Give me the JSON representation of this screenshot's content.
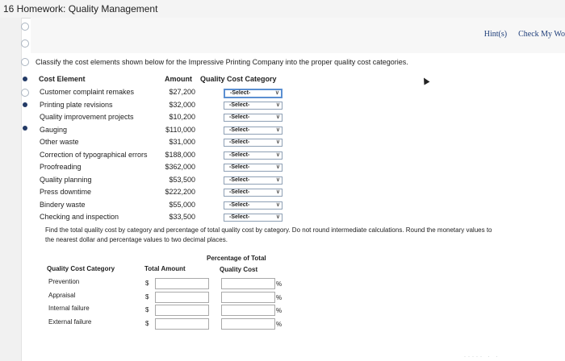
{
  "window_title": "16 Homework: Quality Management",
  "toolbar": {
    "hints_label": "Hint(s)",
    "check_label": "Check My Wo"
  },
  "instructions": "Classify the cost elements shown below for the Impressive Printing Company into the proper quality cost categories.",
  "classify_table": {
    "headers": {
      "element": "Cost Element",
      "amount": "Amount",
      "category": "Quality Cost Category"
    },
    "rows": [
      {
        "element": "Customer complaint remakes",
        "amount": "$27,200",
        "select": "-Select-"
      },
      {
        "element": "Printing plate revisions",
        "amount": "$32,000",
        "select": "-Select-"
      },
      {
        "element": "Quality improvement projects",
        "amount": "$10,200",
        "select": "-Select-"
      },
      {
        "element": "Gauging",
        "amount": "$110,000",
        "select": "-Select-"
      },
      {
        "element": "Other waste",
        "amount": "$31,000",
        "select": "-Select-"
      },
      {
        "element": "Correction of typographical errors",
        "amount": "$188,000",
        "select": "-Select-"
      },
      {
        "element": "Proofreading",
        "amount": "$362,000",
        "select": "-Select-"
      },
      {
        "element": "Quality planning",
        "amount": "$53,500",
        "select": "-Select-"
      },
      {
        "element": "Press downtime",
        "amount": "$222,200",
        "select": "-Select-"
      },
      {
        "element": "Bindery waste",
        "amount": "$55,000",
        "select": "-Select-"
      },
      {
        "element": "Checking and inspection",
        "amount": "$33,500",
        "select": "-Select-"
      }
    ]
  },
  "question2": {
    "line1": "Find the total quality cost by category and percentage of total quality cost by category. Do not round intermediate calculations. Round the monetary values to",
    "line2": "the nearest dollar and percentage values to two decimal places."
  },
  "summary_table": {
    "headers": {
      "category": "Quality Cost Category",
      "total": "Total Amount",
      "pct_line1": "Percentage of Total",
      "pct_line2": "Quality Cost"
    },
    "rows": [
      {
        "category": "Prevention",
        "currency": "$",
        "amount_value": "",
        "pct_value": "",
        "pct_sign": "%"
      },
      {
        "category": "Appraisal",
        "currency": "$",
        "amount_value": "",
        "pct_value": "",
        "pct_sign": "%"
      },
      {
        "category": "Internal failure",
        "currency": "$",
        "amount_value": "",
        "pct_value": "",
        "pct_sign": "%"
      },
      {
        "category": "External failure",
        "currency": "$",
        "amount_value": "",
        "pct_value": "",
        "pct_sign": "%"
      }
    ]
  },
  "icons": {
    "dropdown": "chevron-down-icon",
    "nav_radio": "radio-icon",
    "nav_current": "filled-dot-icon"
  },
  "colors": {
    "link": "#1f3e7a",
    "nav_dot": "#233a66",
    "focus_border": "#5b8fd1"
  }
}
